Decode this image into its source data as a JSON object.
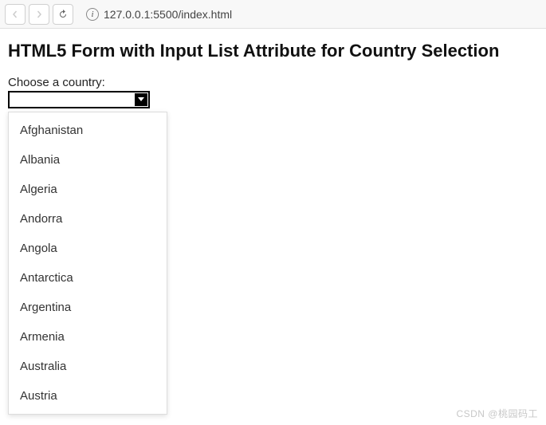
{
  "browser": {
    "url": "127.0.0.1:5500/index.html"
  },
  "page": {
    "title": "HTML5 Form with Input List Attribute for Country Selection"
  },
  "form": {
    "label": "Choose a country:",
    "value": ""
  },
  "datalist": {
    "items": [
      "Afghanistan",
      "Albania",
      "Algeria",
      "Andorra",
      "Angola",
      "Antarctica",
      "Argentina",
      "Armenia",
      "Australia",
      "Austria"
    ]
  },
  "watermark": "CSDN @桃园码工"
}
